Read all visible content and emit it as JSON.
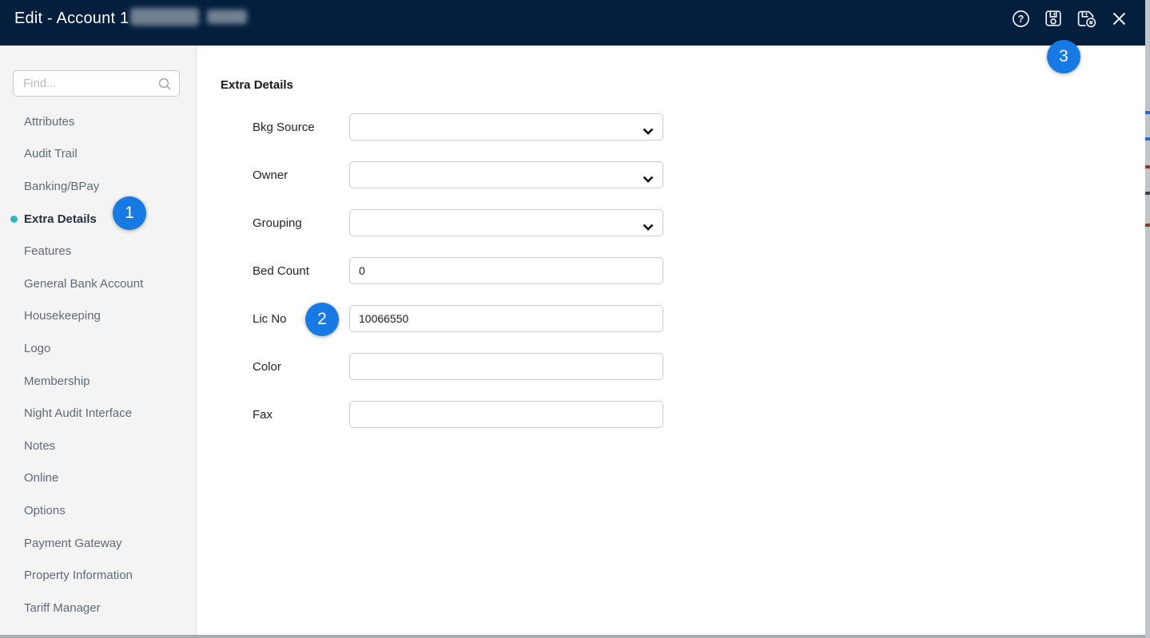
{
  "titlebar": {
    "title": "Edit - Account 1",
    "redacted": "account name redacted",
    "buttons": [
      {
        "name": "help",
        "icon": "help-circle-icon"
      },
      {
        "name": "save",
        "icon": "floppy-save-icon"
      },
      {
        "name": "save-discard",
        "icon": "floppy-save-cancel-icon"
      },
      {
        "name": "close",
        "icon": "close-x-icon"
      }
    ]
  },
  "sidebar": {
    "search": {
      "placeholder": "Find...",
      "value": "",
      "icon": "search-icon"
    },
    "items": [
      {
        "label": "Attributes",
        "selected": false
      },
      {
        "label": "Audit Trail",
        "selected": false
      },
      {
        "label": "Banking/BPay",
        "selected": false
      },
      {
        "label": "Extra Details",
        "selected": true
      },
      {
        "label": "Features",
        "selected": false
      },
      {
        "label": "General Bank Account",
        "selected": false
      },
      {
        "label": "Housekeeping",
        "selected": false
      },
      {
        "label": "Logo",
        "selected": false
      },
      {
        "label": "Membership",
        "selected": false
      },
      {
        "label": "Night Audit Interface",
        "selected": false
      },
      {
        "label": "Notes",
        "selected": false
      },
      {
        "label": "Online",
        "selected": false
      },
      {
        "label": "Options",
        "selected": false
      },
      {
        "label": "Payment Gateway",
        "selected": false
      },
      {
        "label": "Property Information",
        "selected": false
      },
      {
        "label": "Tariff Manager",
        "selected": false
      }
    ]
  },
  "main": {
    "heading": "Extra Details",
    "fields": [
      {
        "label": "Bkg Source",
        "type": "select",
        "value": ""
      },
      {
        "label": "Owner",
        "type": "select",
        "value": ""
      },
      {
        "label": "Grouping",
        "type": "select",
        "value": ""
      },
      {
        "label": "Bed Count",
        "type": "text",
        "value": "0"
      },
      {
        "label": "Lic No",
        "type": "text",
        "value": "10066550"
      },
      {
        "label": "Color",
        "type": "text",
        "value": ""
      },
      {
        "label": "Fax",
        "type": "text",
        "value": ""
      }
    ]
  },
  "annotations": {
    "callouts": [
      "1",
      "2",
      "3"
    ]
  },
  "colors": {
    "titlebar_bg": "#041f3d",
    "callout_blue": "#1779e4",
    "selected_dot_teal": "#2cb4c3",
    "sidebar_bg": "#f4f4f4",
    "sidebar_text": "#5f6b76",
    "selected_text": "#24323f",
    "input_border": "#cbcbcb"
  }
}
